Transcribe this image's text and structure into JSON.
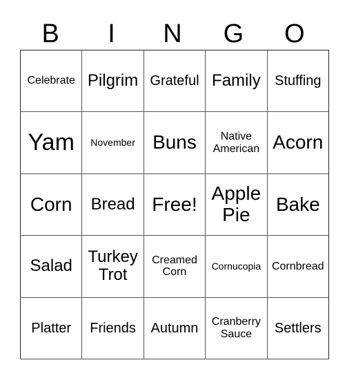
{
  "header": {
    "letters": [
      "B",
      "I",
      "N",
      "G",
      "O"
    ]
  },
  "grid": {
    "rows": [
      [
        "Celebrate",
        "Pilgrim",
        "Grateful",
        "Family",
        "Stuffing"
      ],
      [
        "Yam",
        "November",
        "Buns",
        "Native American",
        "Acorn"
      ],
      [
        "Corn",
        "Bread",
        "Free!",
        "Apple Pie",
        "Bake"
      ],
      [
        "Salad",
        "Turkey Trot",
        "Creamed Corn",
        "Cornucopia",
        "Cornbread"
      ],
      [
        "Platter",
        "Friends",
        "Autumn",
        "Cranberry Sauce",
        "Settlers"
      ]
    ]
  }
}
